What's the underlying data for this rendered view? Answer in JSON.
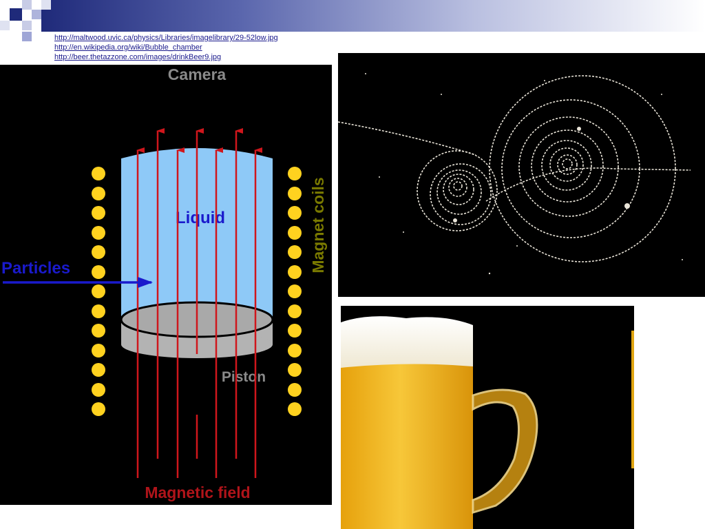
{
  "slide": {
    "links": [
      "http://maltwood.uvic.ca/physics/Libraries/imagelibrary/29-52low.jpg",
      "http://en.wikipedia.org/wiki/Bubble_chamber",
      "http://beer.thetazzone.com/images/drinkBeer9.jpg"
    ],
    "colors": {
      "accent_dark": "#1f2a7a",
      "accent_light": "#9fa6d6",
      "liquid": "#8ec9f7",
      "coil": "#ffd21f",
      "field": "#d0161c",
      "particles": "#1a1acc",
      "coil_label": "#7a7a00"
    }
  },
  "diagram": {
    "camera_label": "Camera",
    "liquid_label": "Liquid",
    "particles_label": "Particles",
    "coils_label": "Magnet coils",
    "piston_label": "Piston",
    "field_label": "Magnetic field"
  }
}
